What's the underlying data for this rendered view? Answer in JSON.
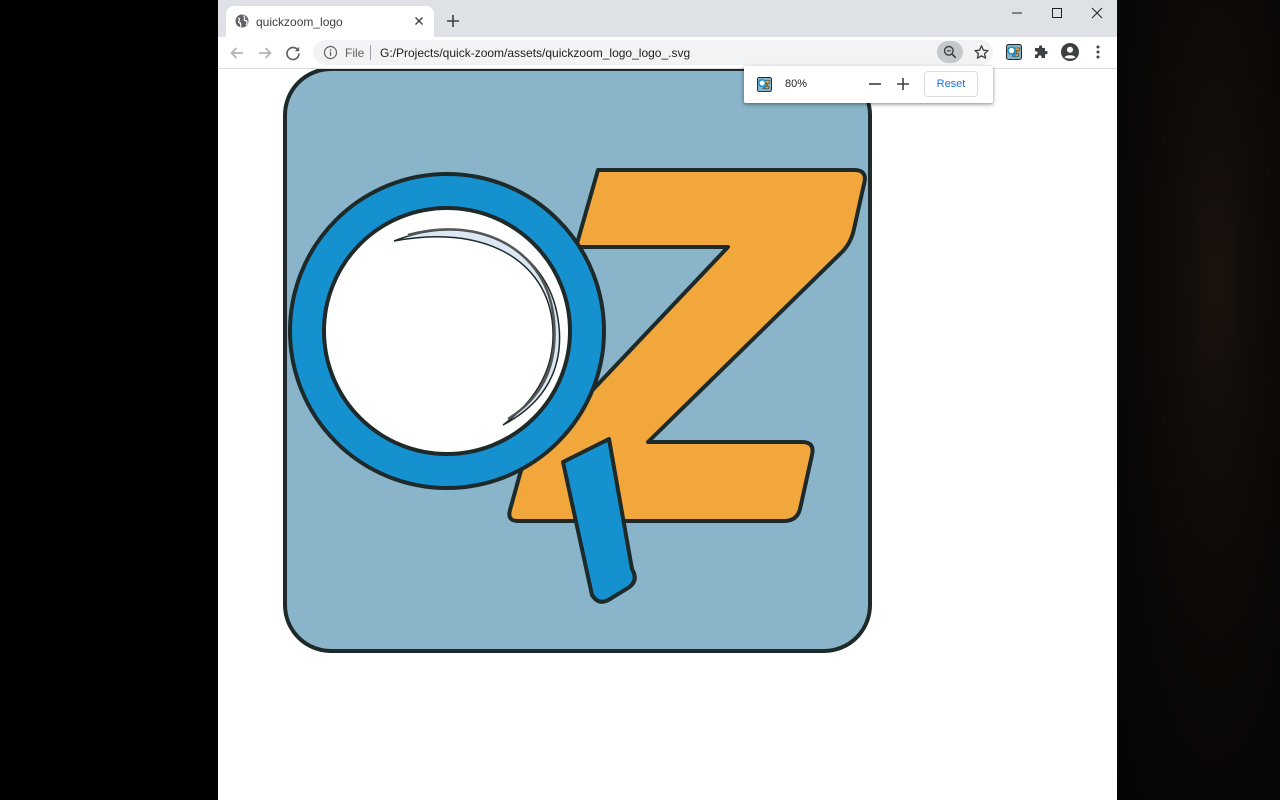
{
  "tab": {
    "title": "quickzoom_logo"
  },
  "omnibox": {
    "scheme_label": "File",
    "url": "G:/Projects/quick-zoom/assets/quickzoom_logo_logo_.svg"
  },
  "zoom_bubble": {
    "zoom_level": "80%",
    "reset_label": "Reset"
  },
  "colors": {
    "tile": "#89b4c9",
    "z_letter": "#f2a73d",
    "lens_ring": "#1591cf",
    "outline": "#1e2a2a"
  },
  "icons": {
    "tab_favicon": "globe-icon",
    "tab_close": "close-icon",
    "new_tab": "plus-icon",
    "back": "arrow-left-icon",
    "forward": "arrow-right-icon",
    "reload": "reload-icon",
    "site_info": "info-icon",
    "zoom": "magnifier-icon",
    "bookmark": "star-icon",
    "extension": "quickzoom-extension-icon",
    "extensions_menu": "puzzle-icon",
    "profile": "account-icon",
    "menu": "more-vert-icon"
  }
}
